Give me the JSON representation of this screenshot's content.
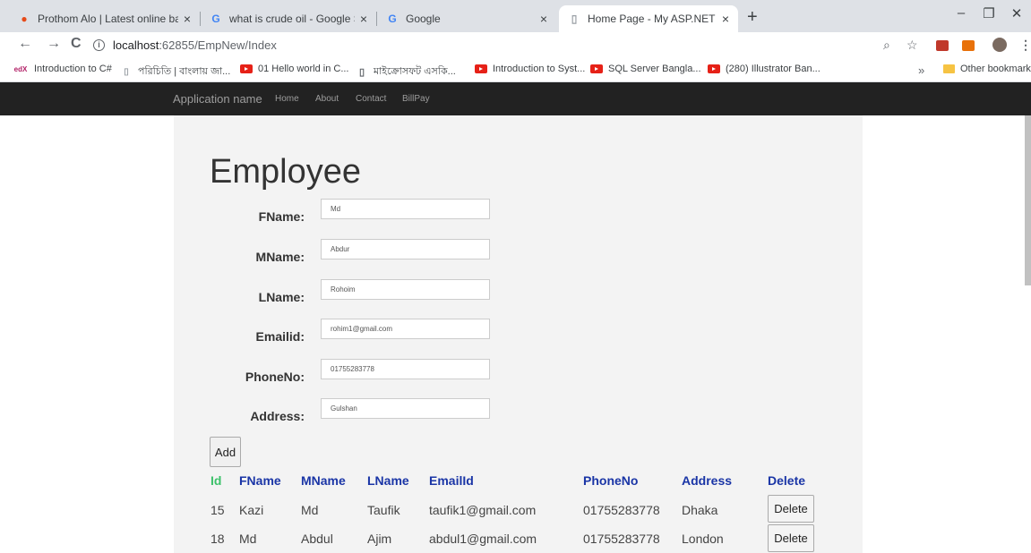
{
  "browser": {
    "tabs": [
      {
        "title": "Prothom Alo | Latest online bang",
        "icon": "prothom-alo-icon"
      },
      {
        "title": "what is crude oil - Google Search",
        "icon": "google-icon"
      },
      {
        "title": "Google",
        "icon": "google-icon"
      },
      {
        "title": "Home Page - My ASP.NET Applic",
        "icon": "page-icon"
      }
    ],
    "address": {
      "host": "localhost",
      "path": ":62855/EmpNew/Index"
    },
    "bookmarks": [
      {
        "label": "Introduction to C#",
        "icon": "edx-icon"
      },
      {
        "label": "পরিচিতি | বাংলায় জা...",
        "icon": "page-icon"
      },
      {
        "label": "01 Hello world in C...",
        "icon": "youtube-icon"
      },
      {
        "label": "মাইক্রোসফট এসকি...",
        "icon": "document-icon"
      },
      {
        "label": "Introduction to Syst...",
        "icon": "youtube-icon"
      },
      {
        "label": "SQL Server Bangla...",
        "icon": "youtube-icon"
      },
      {
        "label": "(280) Illustrator Ban...",
        "icon": "youtube-icon"
      }
    ],
    "other_bookmarks": "Other bookmarks",
    "overflow": "»"
  },
  "site": {
    "brand": "Application name",
    "nav": [
      "Home",
      "About",
      "Contact",
      "BillPay"
    ]
  },
  "form": {
    "title": "Employee",
    "fields": [
      {
        "label": "FName:",
        "value": "Md"
      },
      {
        "label": "MName:",
        "value": "Abdur"
      },
      {
        "label": "LName:",
        "value": "Rohoim"
      },
      {
        "label": "Emailid:",
        "value": "rohim1@gmail.com"
      },
      {
        "label": "PhoneNo:",
        "value": "01755283778"
      },
      {
        "label": "Address:",
        "value": "Gulshan"
      }
    ],
    "add_label": "Add"
  },
  "table": {
    "columns": [
      "Id",
      "FName",
      "MName",
      "LName",
      "EmailId",
      "PhoneNo",
      "Address",
      "Delete"
    ],
    "rows": [
      {
        "id": "15",
        "fname": "Kazi",
        "mname": "Md",
        "lname": "Taufik",
        "email": "taufik1@gmail.com",
        "phone": "01755283778",
        "address": "Dhaka",
        "delete": "Delete"
      },
      {
        "id": "18",
        "fname": "Md",
        "mname": "Abdul",
        "lname": "Ajim",
        "email": "abdul1@gmail.com",
        "phone": "01755283778",
        "address": "London",
        "delete": "Delete"
      }
    ]
  },
  "colors": {
    "header_link": "#1a35a6",
    "id_header": "#3cc16a",
    "navbar": "#222222",
    "panel": "#f3f3f3"
  }
}
